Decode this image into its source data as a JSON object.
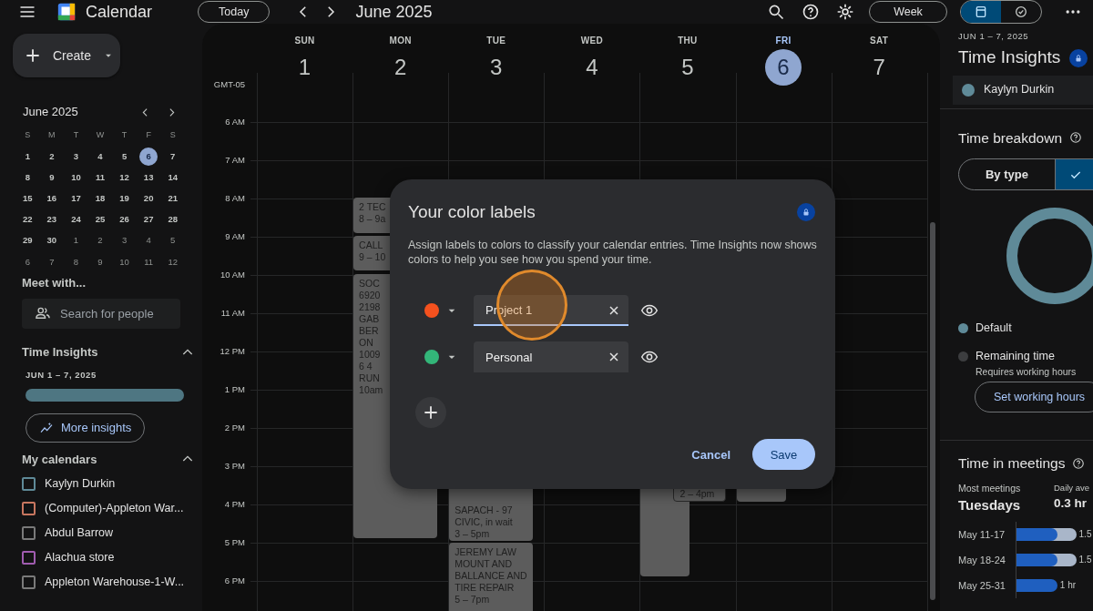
{
  "top_bar": {
    "app_name": "Calendar",
    "today_button": "Today",
    "period": "June 2025",
    "view": "Week",
    "view_toggle": [
      {
        "kind": "calendar",
        "selected": true
      },
      {
        "kind": "tasks",
        "selected": false
      }
    ]
  },
  "sidebar": {
    "create": "Create",
    "mini_calendar": {
      "title": "June 2025",
      "weekdays": [
        "S",
        "M",
        "T",
        "W",
        "T",
        "F",
        "S"
      ],
      "weeks": [
        [
          {
            "day": "1",
            "in_month": true,
            "selected": false
          },
          {
            "day": "2",
            "in_month": true,
            "selected": false
          },
          {
            "day": "3",
            "in_month": true,
            "selected": false
          },
          {
            "day": "4",
            "in_month": true,
            "selected": false
          },
          {
            "day": "5",
            "in_month": true,
            "selected": false
          },
          {
            "day": "6",
            "in_month": true,
            "selected": true
          },
          {
            "day": "7",
            "in_month": true,
            "selected": false
          }
        ],
        [
          {
            "day": "8",
            "in_month": true,
            "selected": false
          },
          {
            "day": "9",
            "in_month": true,
            "selected": false
          },
          {
            "day": "10",
            "in_month": true,
            "selected": false
          },
          {
            "day": "11",
            "in_month": true,
            "selected": false
          },
          {
            "day": "12",
            "in_month": true,
            "selected": false
          },
          {
            "day": "13",
            "in_month": true,
            "selected": false
          },
          {
            "day": "14",
            "in_month": true,
            "selected": false
          }
        ],
        [
          {
            "day": "15",
            "in_month": true,
            "selected": false
          },
          {
            "day": "16",
            "in_month": true,
            "selected": false
          },
          {
            "day": "17",
            "in_month": true,
            "selected": false
          },
          {
            "day": "18",
            "in_month": true,
            "selected": false
          },
          {
            "day": "19",
            "in_month": true,
            "selected": false
          },
          {
            "day": "20",
            "in_month": true,
            "selected": false
          },
          {
            "day": "21",
            "in_month": true,
            "selected": false
          }
        ],
        [
          {
            "day": "22",
            "in_month": true,
            "selected": false
          },
          {
            "day": "23",
            "in_month": true,
            "selected": false
          },
          {
            "day": "24",
            "in_month": true,
            "selected": false
          },
          {
            "day": "25",
            "in_month": true,
            "selected": false
          },
          {
            "day": "26",
            "in_month": true,
            "selected": false
          },
          {
            "day": "27",
            "in_month": true,
            "selected": false
          },
          {
            "day": "28",
            "in_month": true,
            "selected": false
          }
        ],
        [
          {
            "day": "29",
            "in_month": true,
            "selected": false
          },
          {
            "day": "30",
            "in_month": true,
            "selected": false
          },
          {
            "day": "1",
            "in_month": false,
            "selected": false
          },
          {
            "day": "2",
            "in_month": false,
            "selected": false
          },
          {
            "day": "3",
            "in_month": false,
            "selected": false
          },
          {
            "day": "4",
            "in_month": false,
            "selected": false
          },
          {
            "day": "5",
            "in_month": false,
            "selected": false
          }
        ],
        [
          {
            "day": "6",
            "in_month": false,
            "selected": false
          },
          {
            "day": "7",
            "in_month": false,
            "selected": false
          },
          {
            "day": "8",
            "in_month": false,
            "selected": false
          },
          {
            "day": "9",
            "in_month": false,
            "selected": false
          },
          {
            "day": "10",
            "in_month": false,
            "selected": false
          },
          {
            "day": "11",
            "in_month": false,
            "selected": false
          },
          {
            "day": "12",
            "in_month": false,
            "selected": false
          }
        ]
      ]
    },
    "meet_with": {
      "title": "Meet with...",
      "placeholder": "Search for people"
    },
    "time_insights": {
      "title": "Time Insights",
      "expanded": true,
      "range": "JUN 1 – 7, 2025",
      "button": "More insights"
    },
    "my_calendars": {
      "title": "My calendars",
      "expanded": true,
      "items": [
        {
          "name": "Kaylyn Durkin",
          "color": "#5f8a98",
          "checked": false
        },
        {
          "name": "(Computer)-Appleton War...",
          "color": "#c97760",
          "checked": false
        },
        {
          "name": "Abdul Barrow",
          "color": "#7a7a7a",
          "checked": false
        },
        {
          "name": "Alachua store",
          "color": "#a05cb0",
          "checked": false
        },
        {
          "name": "Appleton Warehouse-1-W...",
          "color": "#7a7a7a",
          "checked": false
        }
      ]
    }
  },
  "calendar": {
    "timezone": "GMT-05",
    "hours": [
      "6 AM",
      "7 AM",
      "8 AM",
      "9 AM",
      "10 AM",
      "11 AM",
      "12 PM",
      "1 PM",
      "2 PM",
      "3 PM",
      "4 PM",
      "5 PM",
      "6 PM"
    ],
    "days": [
      {
        "weekday": "SUN",
        "date": "1",
        "selected": false
      },
      {
        "weekday": "MON",
        "date": "2",
        "selected": false,
        "events": [
          {
            "lines": [
              "2 TEC",
              "8 – 9a"
            ]
          },
          {
            "lines": [
              "CALL",
              "9 – 10"
            ]
          },
          {
            "lines": [
              "SOC",
              "6920",
              "2198",
              "GAB",
              "BER",
              "ON",
              "1009",
              "6 4",
              "RUN",
              "10am"
            ]
          }
        ]
      },
      {
        "weekday": "TUE",
        "date": "3",
        "selected": false,
        "events": [
          {
            "lines": [
              "SAPACH - 97",
              "CIVIC, in wait",
              "3 – 5pm"
            ]
          },
          {
            "lines": [
              "JEREMY LAW",
              "MOUNT AND",
              "BALLANCE AND",
              "TIRE REPAIR",
              "5 – 7pm"
            ]
          }
        ]
      },
      {
        "weekday": "WED",
        "date": "4",
        "selected": false
      },
      {
        "weekday": "THU",
        "date": "5",
        "selected": false,
        "events": [
          {
            "lines": [
              "2 – 4pm"
            ]
          }
        ]
      },
      {
        "weekday": "FRI",
        "date": "6",
        "selected": true
      },
      {
        "weekday": "SAT",
        "date": "7",
        "selected": false
      }
    ]
  },
  "dialog": {
    "title": "Your color labels",
    "description": "Assign labels to colors to classify your calendar entries. Time Insights now shows colors to help you see how you spend your time.",
    "labels": [
      {
        "color": "#f4511e",
        "value": "Project 1",
        "focused": true
      },
      {
        "color": "#33b679",
        "value": "Personal",
        "focused": false
      }
    ],
    "cancel": "Cancel",
    "save": "Save"
  },
  "insights_panel": {
    "range": "JUN 1 – 7, 2025",
    "title": "Time Insights",
    "person": {
      "name": "Kaylyn Durkin",
      "color": "#5f8a98"
    },
    "breakdown": {
      "title": "Time breakdown",
      "segments": [
        {
          "kind": "text",
          "label": "By type",
          "selected": false
        },
        {
          "kind": "check",
          "selected": true
        }
      ],
      "legend": [
        {
          "label": "Default",
          "color": "#5f8a98"
        },
        {
          "label": "Remaining time",
          "note": "Requires working hours",
          "color": "#3c3d3f"
        }
      ],
      "button": "Set working hours"
    },
    "meetings": {
      "title": "Time in meetings",
      "stats": [
        {
          "label": "Most meetings",
          "value": "Tuesdays"
        },
        {
          "label": "Daily ave",
          "value": "0.3 hr"
        }
      ],
      "weeks": [
        {
          "label": "May 11-17",
          "value": "1.5",
          "segments": [
            {
              "level": 0.54,
              "color": "#1f5fbf"
            },
            {
              "level": 0.79,
              "color": "#a9b6c9"
            }
          ]
        },
        {
          "label": "May 18-24",
          "value": "1.5",
          "segments": [
            {
              "level": 0.54,
              "color": "#1f5fbf"
            },
            {
              "level": 0.79,
              "color": "#a9b6c9"
            }
          ]
        },
        {
          "label": "May 25-31",
          "value": "1 hr",
          "segments": [
            {
              "level": 0.54,
              "color": "#1f5fbf"
            }
          ]
        }
      ]
    }
  }
}
